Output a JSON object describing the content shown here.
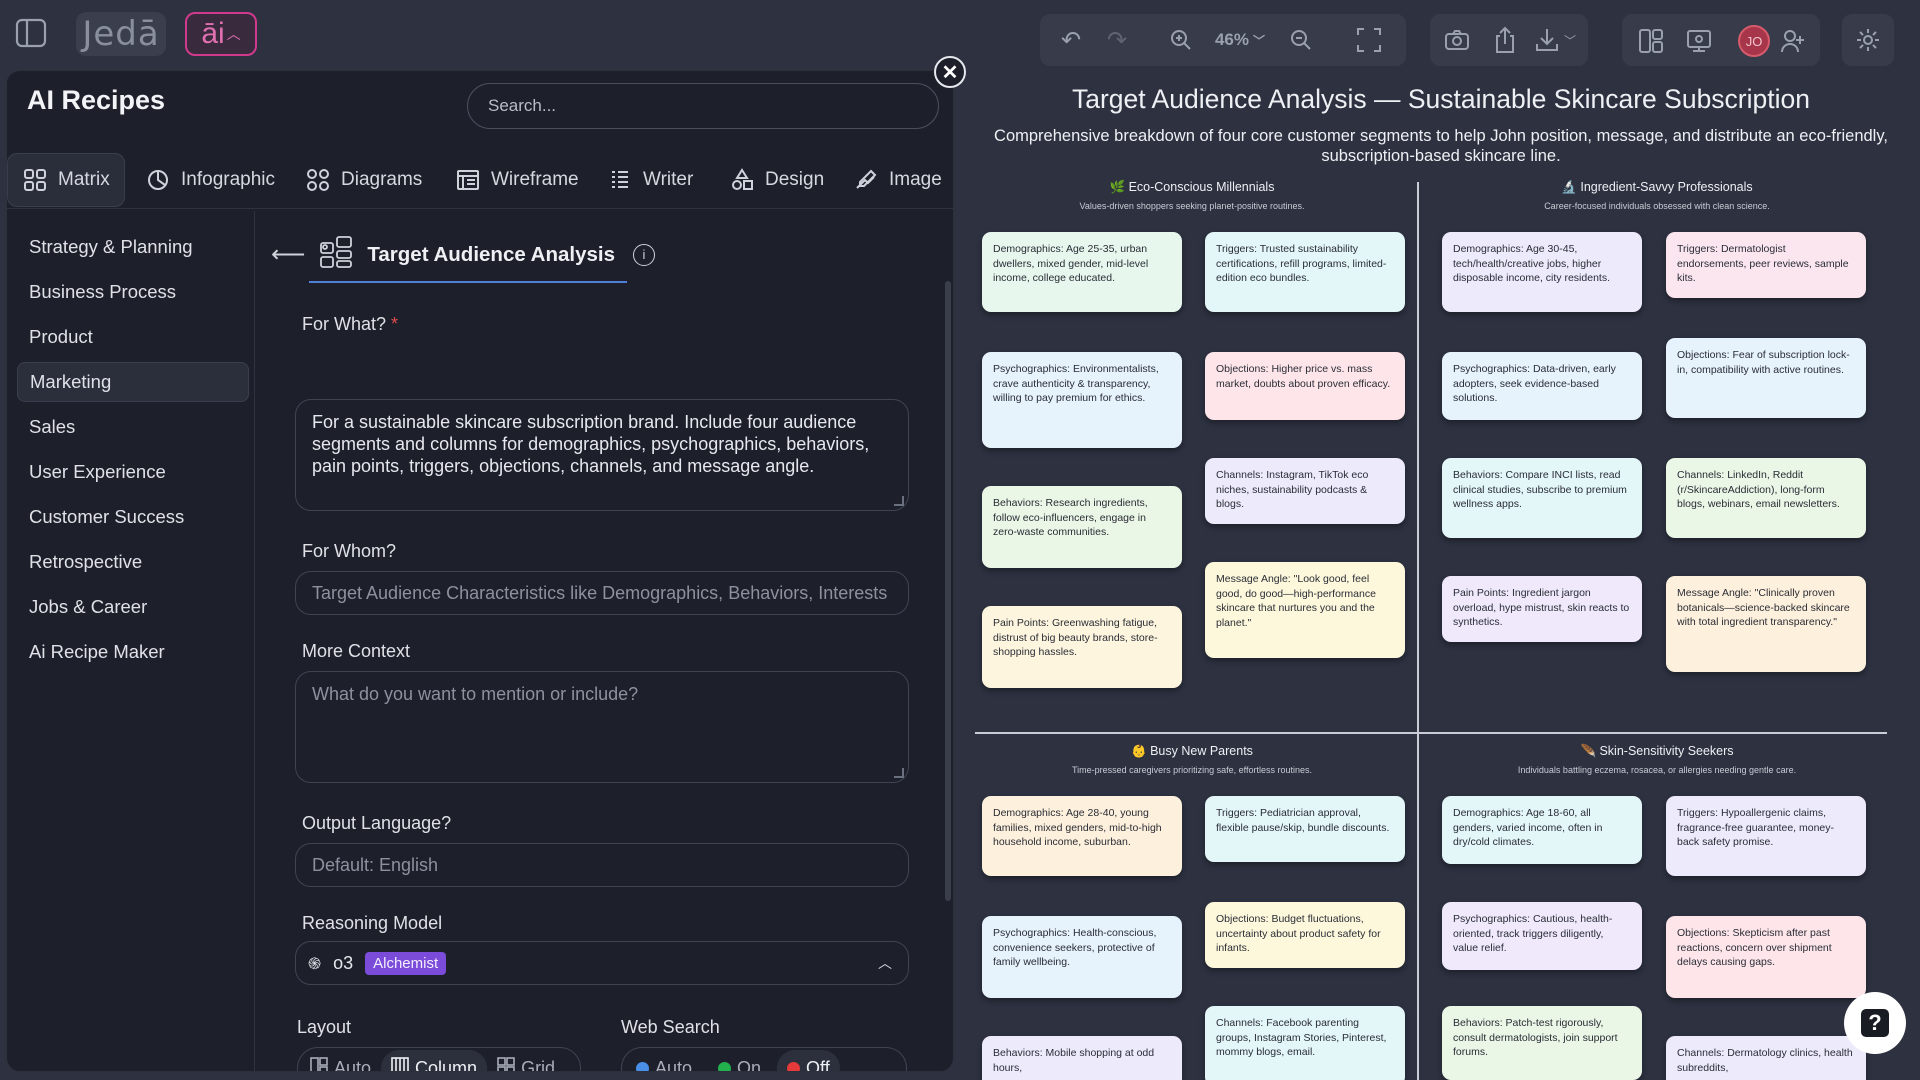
{
  "topbar": {
    "brand": "Jedā",
    "ai_label": "āi",
    "zoom": "46%",
    "avatar_initials": "JO"
  },
  "panel": {
    "title": "AI Recipes",
    "search_placeholder": "Search...",
    "tabs": [
      {
        "label": "Matrix",
        "icon": "matrix-icon"
      },
      {
        "label": "Infographic",
        "icon": "infographic-icon"
      },
      {
        "label": "Diagrams",
        "icon": "diagrams-icon"
      },
      {
        "label": "Wireframe",
        "icon": "wireframe-icon"
      },
      {
        "label": "Writer",
        "icon": "writer-icon"
      },
      {
        "label": "Design",
        "icon": "design-icon"
      },
      {
        "label": "Image",
        "icon": "image-icon"
      }
    ],
    "categories": [
      "Strategy & Planning",
      "Business Process",
      "Product",
      "Marketing",
      "Sales",
      "User Experience",
      "Customer Success",
      "Retrospective",
      "Jobs & Career",
      "Ai Recipe Maker"
    ],
    "active_category": "Marketing"
  },
  "recipe": {
    "title": "Target Audience Analysis",
    "for_what_label": "For What?",
    "for_what_required": "*",
    "for_what_value": "For a sustainable skincare subscription brand. Include four audience segments and columns for demographics, psychographics, behaviors, pain points, triggers, objections, channels, and message angle.",
    "for_whom_label": "For Whom?",
    "for_whom_placeholder": "Target Audience Characteristics like Demographics, Behaviors, Interests",
    "more_context_label": "More Context",
    "more_context_placeholder": "What do you want to mention or include?",
    "output_language_label": "Output Language?",
    "output_language_placeholder": "Default: English",
    "reasoning_label": "Reasoning Model",
    "model_name": "o3",
    "model_badge": "Alchemist",
    "layout_label": "Layout",
    "layout_options": [
      "Auto",
      "Column",
      "Grid"
    ],
    "layout_selected": "Column",
    "web_search_label": "Web Search",
    "web_search_options": [
      "Auto",
      "On",
      "Off"
    ],
    "web_search_selected": "Off",
    "colors": {
      "auto": "#4a8fe7",
      "on": "#22b14c",
      "off": "#e5393a"
    }
  },
  "canvas": {
    "title": "Target Audience Analysis — Sustainable Skincare Subscription",
    "subtitle": "Comprehensive breakdown of four core customer segments to help John position, message, and distribute an eco-friendly, subscription-based skincare line.",
    "segments": [
      {
        "title": "🌿 Eco-Conscious Millennials",
        "subtitle": "Values-driven shoppers seeking planet-positive routines.",
        "left": [
          {
            "text": "Demographics: Age 25-35, urban dwellers, mixed gender, mid-level income, college educated.",
            "color": "#e7f7ee"
          },
          {
            "text": "Psychographics: Environmentalists, crave authenticity & transparency, willing to pay premium for ethics.",
            "color": "#e6f2fc"
          },
          {
            "text": "Behaviors: Research ingredients, follow eco-influencers, engage in zero-waste communities.",
            "color": "#eaf6e6"
          },
          {
            "text": "Pain Points: Greenwashing fatigue, distrust of big beauty brands, store-shopping hassles.",
            "color": "#fdf5de"
          }
        ],
        "right": [
          {
            "text": "Triggers: Trusted sustainability certifications, refill programs, limited-edition eco bundles.",
            "color": "#e3f6f8"
          },
          {
            "text": "Objections: Higher price vs. mass market, doubts about proven efficacy.",
            "color": "#fde5ea"
          },
          {
            "text": "Channels: Instagram, TikTok eco niches, sustainability podcasts & blogs.",
            "color": "#eceafb"
          },
          {
            "text": "Message Angle: \"Look good, feel good, do good—high-performance skincare that nurtures you and the planet.\"",
            "color": "#fdf8dc"
          }
        ]
      },
      {
        "title": "🔬 Ingredient-Savvy Professionals",
        "subtitle": "Career-focused individuals obsessed with clean science.",
        "left": [
          {
            "text": "Demographics: Age 30-45, tech/health/creative jobs, higher disposable income, city residents.",
            "color": "#eceafb"
          },
          {
            "text": "Psychographics: Data-driven, early adopters, seek evidence-based solutions.",
            "color": "#e6f2fc"
          },
          {
            "text": "Behaviors: Compare INCI lists, read clinical studies, subscribe to premium wellness apps.",
            "color": "#e3f6f8"
          },
          {
            "text": "Pain Points: Ingredient jargon overload, hype mistrust, skin reacts to synthetics.",
            "color": "#efe9fb"
          }
        ],
        "right": [
          {
            "text": "Triggers: Dermatologist endorsements, peer reviews, sample kits.",
            "color": "#fbe6f0"
          },
          {
            "text": "Objections: Fear of subscription lock-in, compatibility with active routines.",
            "color": "#e6f2fc"
          },
          {
            "text": "Channels: LinkedIn, Reddit (r/SkincareAddiction), long-form blogs, webinars, email newsletters.",
            "color": "#eaf6e6"
          },
          {
            "text": "Message Angle: \"Clinically proven botanicals—science-backed skincare with total ingredient transparency.\"",
            "color": "#fdf0dc"
          }
        ]
      },
      {
        "title": "👶 Busy New Parents",
        "subtitle": "Time-pressed caregivers prioritizing safe, effortless routines.",
        "left": [
          {
            "text": "Demographics: Age 28-40, young families, mixed genders, mid-to-high household income, suburban.",
            "color": "#fdf0dc"
          },
          {
            "text": "Psychographics: Health-conscious, convenience seekers, protective of family wellbeing.",
            "color": "#e6f2fc"
          },
          {
            "text": "Behaviors: Mobile shopping at odd hours,",
            "color": "#eceafb"
          }
        ],
        "right": [
          {
            "text": "Triggers: Pediatrician approval, flexible pause/skip, bundle discounts.",
            "color": "#e3f6f8"
          },
          {
            "text": "Objections: Budget fluctuations, uncertainty about product safety for infants.",
            "color": "#fdf8dc"
          },
          {
            "text": "Channels: Facebook parenting groups, Instagram Stories, Pinterest, mommy blogs, email.",
            "color": "#e3f6f8"
          }
        ]
      },
      {
        "title": "🪶 Skin-Sensitivity Seekers",
        "subtitle": "Individuals battling eczema, rosacea, or allergies needing gentle care.",
        "left": [
          {
            "text": "Demographics: Age 18-60, all genders, varied income, often in dry/cold climates.",
            "color": "#e3f6f8"
          },
          {
            "text": "Psychographics: Cautious, health-oriented, track triggers diligently, value relief.",
            "color": "#efe9fb"
          },
          {
            "text": "Behaviors: Patch-test rigorously, consult dermatologists, join support forums.",
            "color": "#eaf6e6"
          }
        ],
        "right": [
          {
            "text": "Triggers: Hypoallergenic claims, fragrance-free guarantee, money-back safety promise.",
            "color": "#eceafb"
          },
          {
            "text": "Objections: Skepticism after past reactions, concern over shipment delays causing gaps.",
            "color": "#fde5ea"
          },
          {
            "text": "Channels: Dermatology clinics, health subreddits,",
            "color": "#eceafb"
          }
        ]
      }
    ]
  }
}
